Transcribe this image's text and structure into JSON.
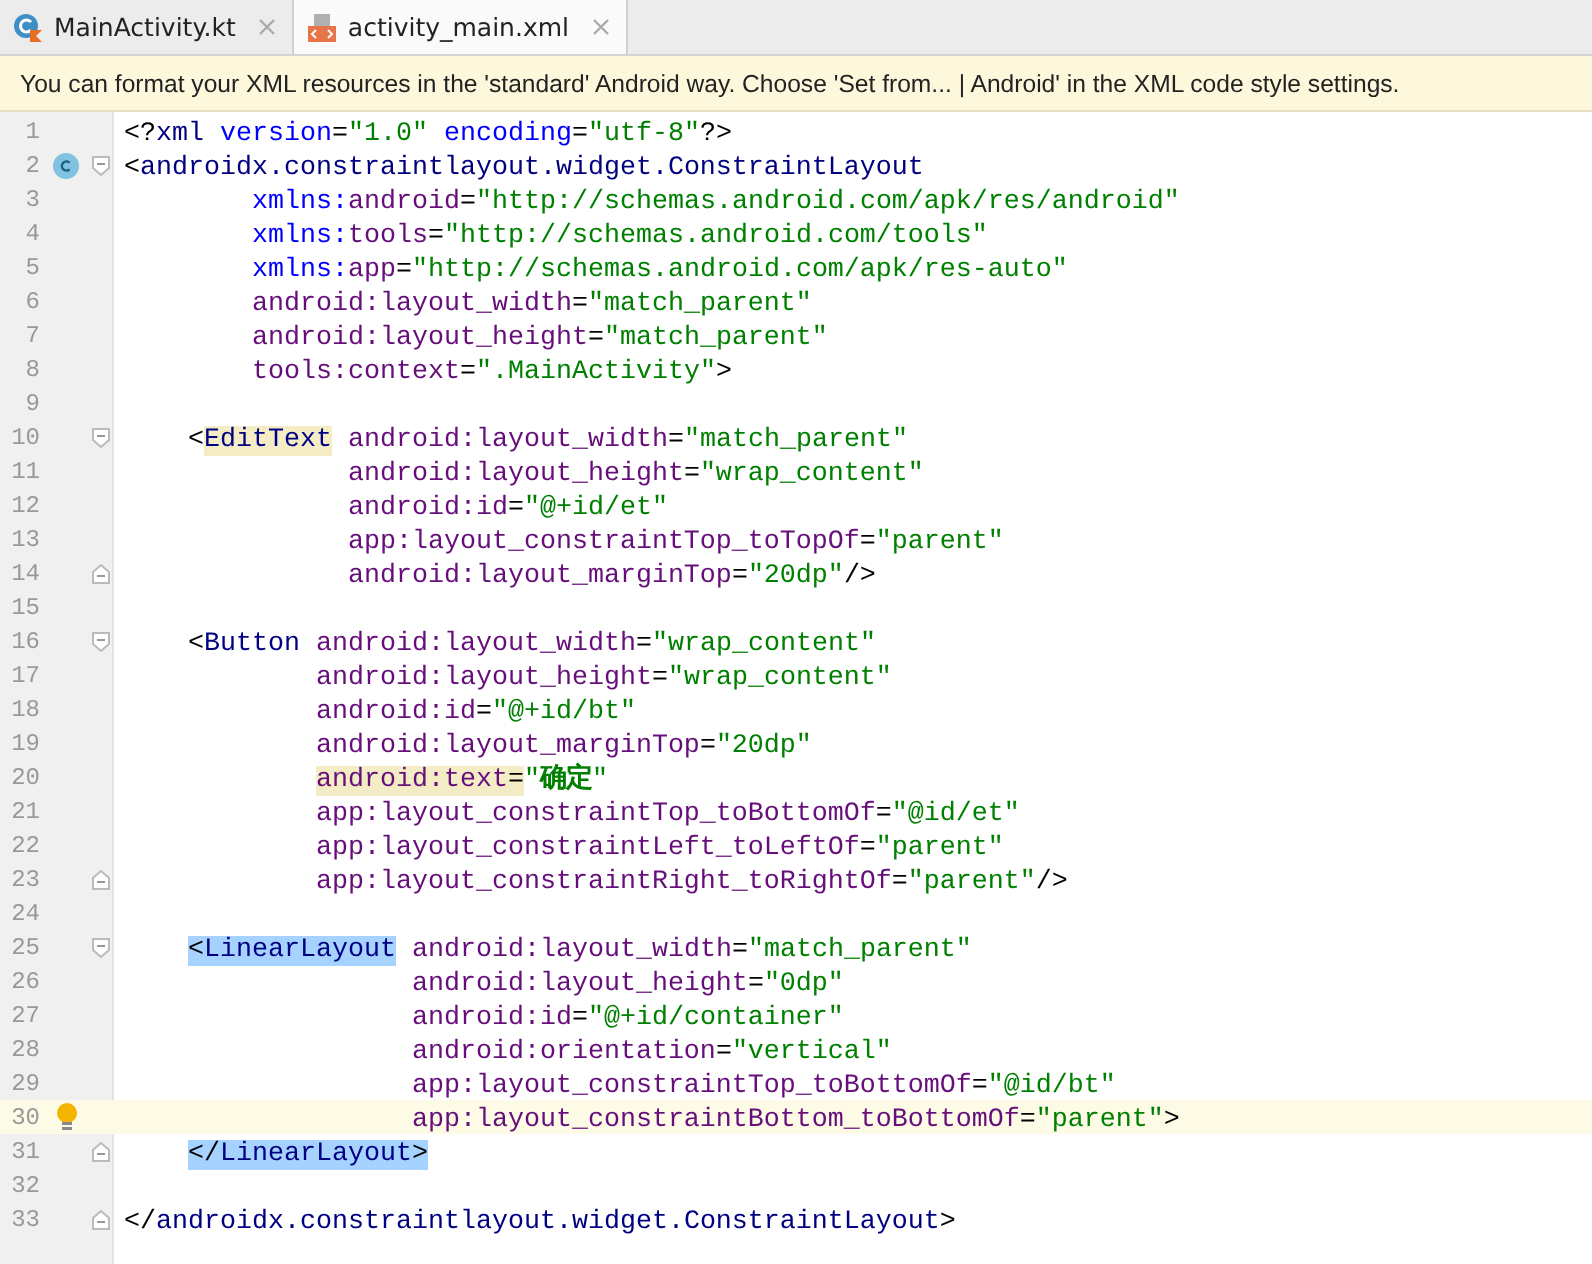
{
  "tabs": [
    {
      "label": "MainActivity.kt",
      "kind": "kotlin",
      "selected": false
    },
    {
      "label": "activity_main.xml",
      "kind": "xml",
      "selected": true
    }
  ],
  "banner": {
    "text": "You can format your XML resources in the 'standard' Android way. Choose 'Set from... | Android' in the XML code style settings."
  },
  "lines": [
    {
      "number": "1",
      "tokens": [
        {
          "kind": "punct",
          "text": "<?"
        },
        {
          "kind": "tag",
          "text": "xml"
        },
        {
          "kind": "ns",
          "text": " version"
        },
        {
          "kind": "punct",
          "text": "="
        },
        {
          "kind": "value",
          "text": "\"1.0\""
        },
        {
          "kind": "ns",
          "text": " encoding"
        },
        {
          "kind": "punct",
          "text": "="
        },
        {
          "kind": "value",
          "text": "\"utf-8\""
        },
        {
          "kind": "punct",
          "text": "?>"
        }
      ]
    },
    {
      "number": "2",
      "class_marker": true,
      "fold_start": true,
      "tokens": [
        {
          "kind": "punct",
          "text": "<"
        },
        {
          "kind": "tag",
          "text": "androidx.constraintlayout.widget.ConstraintLayout"
        }
      ]
    },
    {
      "number": "3",
      "tokens": [
        {
          "kind": "ns",
          "text": "        xmlns:"
        },
        {
          "kind": "attr",
          "text": "android"
        },
        {
          "kind": "punct",
          "text": "="
        },
        {
          "kind": "value",
          "text": "\"http://schemas.android.com/apk/res/android\""
        }
      ]
    },
    {
      "number": "4",
      "tokens": [
        {
          "kind": "ns",
          "text": "        xmlns:"
        },
        {
          "kind": "attr",
          "text": "tools"
        },
        {
          "kind": "punct",
          "text": "="
        },
        {
          "kind": "value",
          "text": "\"http://schemas.android.com/tools\""
        }
      ]
    },
    {
      "number": "5",
      "tokens": [
        {
          "kind": "ns",
          "text": "        xmlns:"
        },
        {
          "kind": "attr",
          "text": "app"
        },
        {
          "kind": "punct",
          "text": "="
        },
        {
          "kind": "value",
          "text": "\"http://schemas.android.com/apk/res-auto\""
        }
      ]
    },
    {
      "number": "6",
      "tokens": [
        {
          "kind": "attr",
          "text": "        android:layout_width"
        },
        {
          "kind": "punct",
          "text": "="
        },
        {
          "kind": "value",
          "text": "\"match_parent\""
        }
      ]
    },
    {
      "number": "7",
      "tokens": [
        {
          "kind": "attr",
          "text": "        android:layout_height"
        },
        {
          "kind": "punct",
          "text": "="
        },
        {
          "kind": "value",
          "text": "\"match_parent\""
        }
      ]
    },
    {
      "number": "8",
      "tokens": [
        {
          "kind": "attr",
          "text": "        tools:context"
        },
        {
          "kind": "punct",
          "text": "="
        },
        {
          "kind": "value",
          "text": "\".MainActivity\""
        },
        {
          "kind": "punct",
          "text": ">"
        }
      ]
    },
    {
      "number": "9"
    },
    {
      "number": "10",
      "fold_start": true,
      "tokens": [
        {
          "kind": "punct",
          "text": "    <"
        },
        {
          "kind": "tag",
          "text": "EditText",
          "matched": true
        },
        {
          "kind": "attr",
          "text": " android:layout_width"
        },
        {
          "kind": "punct",
          "text": "="
        },
        {
          "kind": "value",
          "text": "\"match_parent\""
        }
      ]
    },
    {
      "number": "11",
      "tokens": [
        {
          "kind": "attr",
          "text": "              android:layout_height"
        },
        {
          "kind": "punct",
          "text": "="
        },
        {
          "kind": "value",
          "text": "\"wrap_content\""
        }
      ]
    },
    {
      "number": "12",
      "tokens": [
        {
          "kind": "attr",
          "text": "              android:id"
        },
        {
          "kind": "punct",
          "text": "="
        },
        {
          "kind": "value",
          "text": "\"@+id/et\""
        }
      ]
    },
    {
      "number": "13",
      "tokens": [
        {
          "kind": "attr",
          "text": "              app:layout_constraintTop_toTopOf"
        },
        {
          "kind": "punct",
          "text": "="
        },
        {
          "kind": "value",
          "text": "\"parent\""
        }
      ]
    },
    {
      "number": "14",
      "fold_end": true,
      "tokens": [
        {
          "kind": "attr",
          "text": "              android:layout_marginTop"
        },
        {
          "kind": "punct",
          "text": "="
        },
        {
          "kind": "value",
          "text": "\"20dp\""
        },
        {
          "kind": "punct",
          "text": "/>"
        }
      ]
    },
    {
      "number": "15"
    },
    {
      "number": "16",
      "fold_start": true,
      "tokens": [
        {
          "kind": "punct",
          "text": "    <"
        },
        {
          "kind": "tag",
          "text": "Button"
        },
        {
          "kind": "attr",
          "text": " android:layout_width"
        },
        {
          "kind": "punct",
          "text": "="
        },
        {
          "kind": "value",
          "text": "\"wrap_content\""
        }
      ]
    },
    {
      "number": "17",
      "tokens": [
        {
          "kind": "attr",
          "text": "            android:layout_height"
        },
        {
          "kind": "punct",
          "text": "="
        },
        {
          "kind": "value",
          "text": "\"wrap_content\""
        }
      ]
    },
    {
      "number": "18",
      "tokens": [
        {
          "kind": "attr",
          "text": "            android:id"
        },
        {
          "kind": "punct",
          "text": "="
        },
        {
          "kind": "value",
          "text": "\"@+id/bt\""
        }
      ]
    },
    {
      "number": "19",
      "tokens": [
        {
          "kind": "attr",
          "text": "            android:layout_marginTop"
        },
        {
          "kind": "punct",
          "text": "="
        },
        {
          "kind": "value",
          "text": "\"20dp\""
        }
      ]
    },
    {
      "number": "20",
      "tokens": [
        {
          "kind": "attr",
          "text": "            android:text",
          "matched": true
        },
        {
          "kind": "punct",
          "text": "=",
          "matched": true
        },
        {
          "kind": "value",
          "text": "\""
        },
        {
          "kind": "cjk",
          "text": "确定"
        },
        {
          "kind": "value",
          "text": "\""
        }
      ]
    },
    {
      "number": "21",
      "tokens": [
        {
          "kind": "attr",
          "text": "            app:layout_constraintTop_toBottomOf"
        },
        {
          "kind": "punct",
          "text": "="
        },
        {
          "kind": "value",
          "text": "\"@id/et\""
        }
      ]
    },
    {
      "number": "22",
      "tokens": [
        {
          "kind": "attr",
          "text": "            app:layout_constraintLeft_toLeftOf"
        },
        {
          "kind": "punct",
          "text": "="
        },
        {
          "kind": "value",
          "text": "\"parent\""
        }
      ]
    },
    {
      "number": "23",
      "fold_end": true,
      "tokens": [
        {
          "kind": "attr",
          "text": "            app:layout_constraintRight_toRightOf"
        },
        {
          "kind": "punct",
          "text": "="
        },
        {
          "kind": "value",
          "text": "\"parent\""
        },
        {
          "kind": "punct",
          "text": "/>"
        }
      ]
    },
    {
      "number": "24"
    },
    {
      "number": "25",
      "fold_start": true,
      "tokens": [
        {
          "kind": "punct",
          "text": "    <",
          "selected": true
        },
        {
          "kind": "tag",
          "text": "LinearLayout",
          "selected": true
        },
        {
          "kind": "attr",
          "text": " android:layout_width"
        },
        {
          "kind": "punct",
          "text": "="
        },
        {
          "kind": "value",
          "text": "\"match_parent\""
        }
      ]
    },
    {
      "number": "26",
      "tokens": [
        {
          "kind": "attr",
          "text": "                  android:layout_height"
        },
        {
          "kind": "punct",
          "text": "="
        },
        {
          "kind": "value",
          "text": "\"0dp\""
        }
      ]
    },
    {
      "number": "27",
      "tokens": [
        {
          "kind": "attr",
          "text": "                  android:id"
        },
        {
          "kind": "punct",
          "text": "="
        },
        {
          "kind": "value",
          "text": "\"@+id/container\""
        }
      ]
    },
    {
      "number": "28",
      "tokens": [
        {
          "kind": "attr",
          "text": "                  android:orientation"
        },
        {
          "kind": "punct",
          "text": "="
        },
        {
          "kind": "value",
          "text": "\"vertical\""
        }
      ]
    },
    {
      "number": "29",
      "tokens": [
        {
          "kind": "attr",
          "text": "                  app:layout_constraintTop_toBottomOf"
        },
        {
          "kind": "punct",
          "text": "="
        },
        {
          "kind": "value",
          "text": "\"@id/bt\""
        }
      ]
    },
    {
      "number": "30",
      "current": true,
      "bulb": true,
      "tokens": [
        {
          "kind": "attr",
          "text": "                  app:layout_constraintBottom_toBottomOf"
        },
        {
          "kind": "punct",
          "text": "="
        },
        {
          "kind": "value",
          "text": "\"parent\""
        },
        {
          "kind": "punct",
          "text": ">"
        }
      ]
    },
    {
      "number": "31",
      "fold_end": true,
      "tokens": [
        {
          "kind": "punct",
          "text": "    </",
          "selected": true
        },
        {
          "kind": "tag",
          "text": "LinearLayout",
          "selected": true
        },
        {
          "kind": "punct",
          "text": ">",
          "selected": true
        }
      ]
    },
    {
      "number": "32"
    },
    {
      "number": "33",
      "fold_end": true,
      "tokens": [
        {
          "kind": "punct",
          "text": "</"
        },
        {
          "kind": "tag",
          "text": "androidx.constraintlayout.widget.ConstraintLayout"
        },
        {
          "kind": "punct",
          "text": ">"
        }
      ]
    }
  ]
}
